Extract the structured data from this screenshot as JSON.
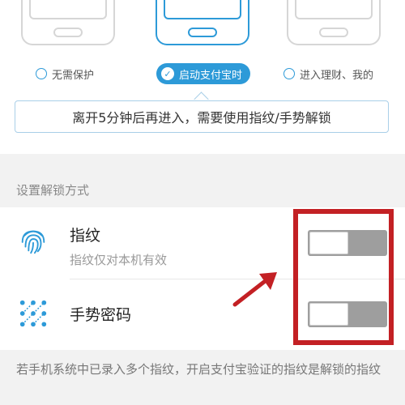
{
  "options": [
    {
      "label": "无需保护",
      "selected": false
    },
    {
      "label": "启动支付宝时",
      "selected": true
    },
    {
      "label": "进入理财、我的",
      "selected": false
    }
  ],
  "hint": "离开5分钟后再进入，需要使用指纹/手势解锁",
  "section_label": "设置解锁方式",
  "methods": [
    {
      "title": "指纹",
      "subtitle": "指纹仅对本机有效",
      "icon": "fingerprint-icon",
      "enabled": false
    },
    {
      "title": "手势密码",
      "icon": "gesture-pattern-icon",
      "enabled": false
    }
  ],
  "note": "若手机系统中已录入多个指纹，开启支付宝验证的指纹是解锁的指纹",
  "colors": {
    "accent": "#2d9ad8",
    "highlight": "#c32024",
    "toggle_off": "#9e9e9e"
  }
}
